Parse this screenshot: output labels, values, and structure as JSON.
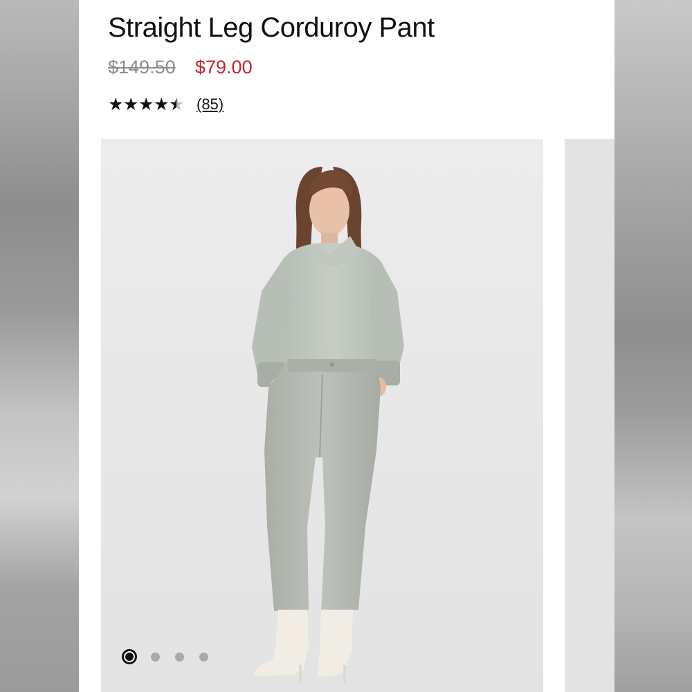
{
  "product": {
    "title": "Straight Leg Corduroy Pant",
    "original_price": "$149.50",
    "sale_price": "$79.00",
    "rating": 4.5,
    "rating_max": 5,
    "review_count": "(85)"
  },
  "gallery": {
    "image_subject": "model-wearing-sage-corduroy-pants",
    "slide_count": 4,
    "active_slide": 1
  },
  "colors": {
    "sale_price": "#c4242b",
    "original_price": "#8c8c8c",
    "product_color": "#b8bdb5"
  },
  "icons": {
    "rating_star": "star-icon",
    "carousel_dot": "dot-indicator"
  }
}
